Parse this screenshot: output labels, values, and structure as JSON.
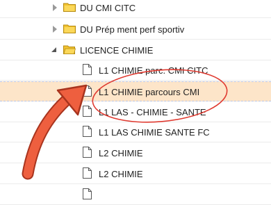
{
  "tree": {
    "nodes": [
      {
        "label": "DU CMI CITC",
        "type": "folder",
        "state": "collapsed"
      },
      {
        "label": "DU Prép ment perf sportiv",
        "type": "folder",
        "state": "collapsed"
      },
      {
        "label": "LICENCE CHIMIE",
        "type": "folder",
        "state": "expanded"
      },
      {
        "label": "L1 CHIMIE parc. CMI CITC",
        "type": "file"
      },
      {
        "label": "L1 CHIMIE parcours CMI",
        "type": "file",
        "selected": true
      },
      {
        "label": "L1 LAS - CHIMIE - SANTE",
        "type": "file"
      },
      {
        "label": "L1 LAS CHIMIE SANTE FC",
        "type": "file"
      },
      {
        "label": "L2 CHIMIE",
        "type": "file"
      },
      {
        "label": "L2 CHIMIE",
        "type": "file"
      }
    ]
  },
  "colors": {
    "selection": "#fde5c9",
    "folder": "#f2c230",
    "annotation": "#e8563a"
  }
}
